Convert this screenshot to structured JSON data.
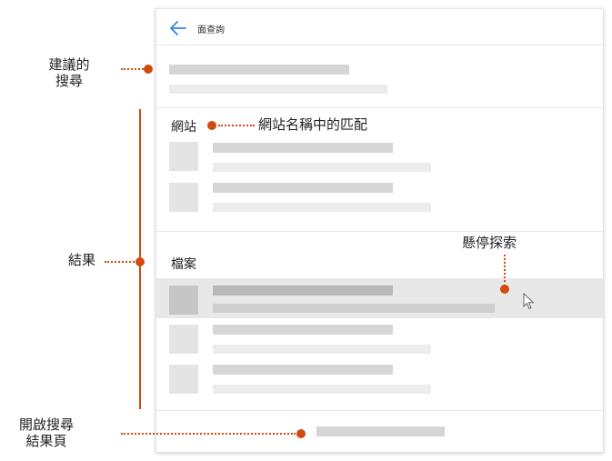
{
  "panel": {
    "title": "面查詢",
    "sections": {
      "sites": "網站",
      "files": "檔案"
    }
  },
  "annotations": {
    "suggested_search": "建議的\n搜尋",
    "results": "結果",
    "sites_match": "網站名稱中的匹配",
    "hover_explore": "懸停探索",
    "open_results": "開啟搜尋\n結果頁"
  },
  "icons": {
    "back": "back-arrow-icon",
    "cursor": "mouse-pointer-icon"
  },
  "colors": {
    "accent": "#d24a0f",
    "back_arrow": "#2f86d6",
    "placeholder": "#d6d6d6",
    "hover": "#e8e8e8"
  }
}
